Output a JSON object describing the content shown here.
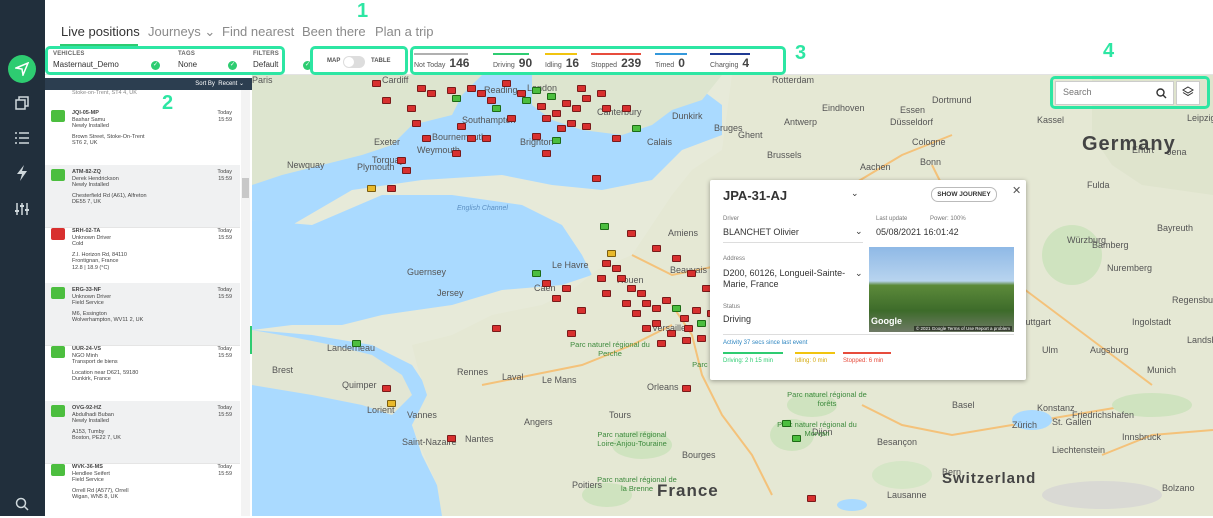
{
  "colors": {
    "accent": "#2ecc71",
    "highlight": "#2de6a3",
    "sidebar": "#212f3c",
    "not_today": "#b0b0b0",
    "driving": "#2ecc71",
    "idling": "#f1c40f",
    "stopped": "#e74c3c",
    "timed": "#3498db",
    "charging": "#1f3a93"
  },
  "sidebar": {
    "icons": [
      "navigate-icon",
      "cube-icon",
      "list-icon",
      "lightning-icon",
      "sliders-icon",
      "search-icon"
    ]
  },
  "nav": {
    "tabs": [
      "Live positions",
      "Journeys ⌄",
      "Find nearest",
      "Been there",
      "Plan a trip"
    ]
  },
  "callouts": [
    "1",
    "2",
    "3",
    "4"
  ],
  "filters": {
    "vehicles": {
      "label": "VEHICLES",
      "value": "Masternaut_Demo"
    },
    "tags": {
      "label": "TAGS",
      "value": "None"
    },
    "filters": {
      "label": "FILTERS",
      "value": "Default"
    }
  },
  "view_toggle": {
    "map": "MAP",
    "table": "TABLE"
  },
  "stats": [
    {
      "label": "Not Today",
      "value": "146"
    },
    {
      "label": "Driving",
      "value": "90"
    },
    {
      "label": "Idling",
      "value": "16"
    },
    {
      "label": "Stopped",
      "value": "239"
    },
    {
      "label": "Timed",
      "value": "0"
    },
    {
      "label": "Charging",
      "value": "4"
    }
  ],
  "list": {
    "sort_label": "Sort By",
    "sort_value": "Recent ⌄",
    "top_partial": "Stoke-on-Trent, ST4 4, UK",
    "rows": [
      {
        "plate": "JQI-05-MP",
        "driver": "Bashar Samu",
        "note": "Newly Installed",
        "addr1": "Brown Street, Stoke-On-Trent",
        "addr2": "ST6 2, UK",
        "day": "Today",
        "time": "15:59",
        "color": "#4cbe3f"
      },
      {
        "plate": "ATM-82-ZQ",
        "driver": "Derek Hendrickson",
        "note": "Newly Installed",
        "addr1": "Chesterfield Rd (A61), Alfreton",
        "addr2": "DE55 7, UK",
        "day": "Today",
        "time": "15:59",
        "color": "#4cbe3f"
      },
      {
        "plate": "SRH-02-TA",
        "driver": "Unknown Driver",
        "note": "Cold",
        "addr1": "Z.I. Horizon Rd, 84110",
        "addr2": "Frontignan, France",
        "extra": "12.8 | 18.9 (°C)",
        "day": "Today",
        "time": "15:59",
        "color": "#d8302f"
      },
      {
        "plate": "ERG-33-NF",
        "driver": "Unknown Driver",
        "note": "Field Service",
        "addr1": "M6, Essington",
        "addr2": "Wolverhampton, WV11 2, UK",
        "day": "Today",
        "time": "15:59",
        "color": "#4cbe3f"
      },
      {
        "plate": "UUR-24-VS",
        "driver": "NGO Minh",
        "note": "Transport de biens",
        "addr1": "Location near D621, 59180",
        "addr2": "Dunkirk, France",
        "day": "Today",
        "time": "15:59",
        "color": "#4cbe3f"
      },
      {
        "plate": "OVG-92-HZ",
        "driver": "Abdulhadi Buban",
        "note": "Newly Installed",
        "addr1": "A153, Tumby",
        "addr2": "Boston, PE22 7, UK",
        "day": "Today",
        "time": "15:59",
        "color": "#4cbe3f"
      },
      {
        "plate": "WVK-36-MS",
        "driver": "Hendlee Seifert",
        "note": "Field Service",
        "addr1": "Orrell Rd (A577), Orrell",
        "addr2": "Wigan, WN5 8, UK",
        "day": "Today",
        "time": "15:59",
        "color": "#4cbe3f"
      }
    ]
  },
  "map": {
    "search_placeholder": "Search",
    "labels": [
      "Rotterdam",
      "Dortmund",
      "Eindhoven",
      "Essen",
      "Düsseldorf",
      "Antwerp",
      "Ghent",
      "Bruges",
      "Dunkirk",
      "Calais",
      "Brussels",
      "Cologne",
      "Bonn",
      "Aachen",
      "Kassel",
      "Fulda",
      "Leipzig",
      "Würzburg",
      "Nuremberg",
      "Regensburg",
      "Ingolstadt",
      "Augsburg",
      "Munich",
      "Ulm",
      "Stuttgart",
      "Strasbourg",
      "Zürich",
      "St. Gallen",
      "Innsbruck",
      "Bolzano",
      "Liechtenstein",
      "Lausanne",
      "Bern",
      "Basel",
      "Dijon",
      "Besançon",
      "Bourges",
      "Orleans",
      "Le Mans",
      "Rennes",
      "Nantes",
      "Angers",
      "Tours",
      "Poitiers",
      "Caen",
      "Le Havre",
      "Amiens",
      "Beauvais",
      "Rouen",
      "Paris",
      "Versailles",
      "Guernsey",
      "Jersey",
      "Brest",
      "Quimper",
      "Landerneau",
      "Lorient",
      "Vannes",
      "Saint-Nazaire",
      "Laval",
      "Plymouth",
      "Torquay",
      "Bournemouth",
      "Southampton",
      "Brighton",
      "Reading",
      "London",
      "Canterbury",
      "Exeter",
      "Weymouth",
      "Cardiff",
      "Newquay",
      "English Channel",
      "Konstanz",
      "Friedrichshafen",
      "Bamberg",
      "Erfurt",
      "Jena",
      "Bayreuth",
      "Landshut"
    ],
    "countries": [
      "Germany",
      "France",
      "Switzerland"
    ],
    "parks": [
      "Parc naturel régional du Perche",
      "Parc naturel régional Loire-Anjou-Touraine",
      "Parc naturel régional du Morvan",
      "Parc naturel régional de la Brenne",
      "Parc naturel régional de Chartres",
      "Parc naturel régional de forêts"
    ]
  },
  "popup": {
    "plate": "JPA-31-AJ",
    "show_journey": "SHOW JOURNEY",
    "driver_label": "Driver",
    "driver": "BLANCHET Olivier",
    "last_update_label": "Last update",
    "power_label": "Power: 100%",
    "last_update": "05/08/2021 16:01:42",
    "address_label": "Address",
    "address": "D200, 60126, Longueil-Sainte-Marie, France",
    "status_label": "Status",
    "status": "Driving",
    "activity": "Activity 37 secs since last event",
    "driving": "Driving: 2 h 15 min",
    "idling": "Idling: 0 min",
    "stopped": "Stopped: 6 min",
    "photo_credit": "© 2021 Google   Terms of Use   Report a problem",
    "google": "Google"
  }
}
